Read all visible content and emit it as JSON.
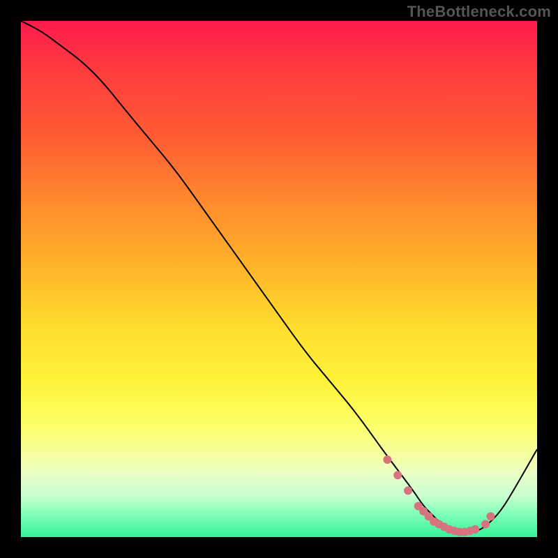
{
  "watermark": "TheBottleneck.com",
  "colors": {
    "curve": "#000000",
    "dot": "#d6737e",
    "frame_bg": "#000000"
  },
  "chart_data": {
    "type": "line",
    "title": "",
    "xlabel": "",
    "ylabel": "",
    "xlim": [
      0,
      100
    ],
    "ylim": [
      0,
      100
    ],
    "grid": false,
    "legend": false,
    "note": "Axes are unlabeled in the source image; x/y in percent of plot area, y=0 at bottom.",
    "series": [
      {
        "name": "curve",
        "x": [
          0,
          4,
          8,
          12,
          16,
          20,
          25,
          30,
          35,
          40,
          45,
          50,
          55,
          60,
          65,
          70,
          73,
          76,
          78,
          80,
          82,
          85,
          88,
          90,
          93,
          96,
          100
        ],
        "y": [
          100,
          98,
          95,
          92,
          88,
          83,
          77,
          71,
          64,
          57,
          50,
          43,
          36,
          30,
          24,
          17,
          13,
          9,
          6,
          4,
          2,
          1,
          1,
          2,
          5,
          10,
          17
        ]
      }
    ],
    "markers": {
      "name": "highlight-dots",
      "x": [
        71,
        73,
        75,
        77,
        78,
        79,
        80,
        81,
        82,
        83,
        84,
        85,
        86,
        87,
        88,
        90,
        91
      ],
      "y": [
        15,
        12,
        9,
        6,
        5,
        4,
        3,
        2.5,
        2,
        1.5,
        1.2,
        1,
        1,
        1.2,
        1.5,
        2.5,
        4
      ]
    }
  }
}
